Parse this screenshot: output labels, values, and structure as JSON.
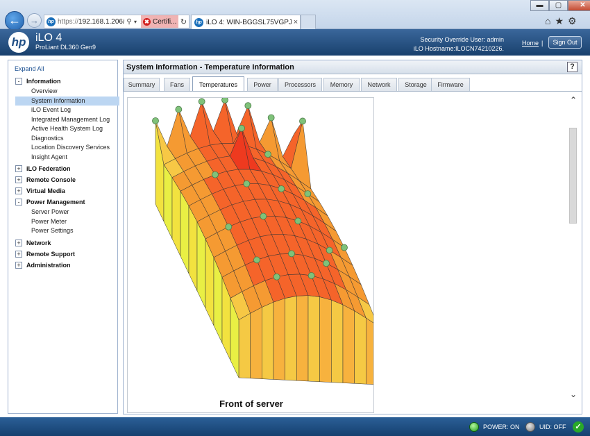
{
  "browser": {
    "url_prefix": "https://",
    "url_host": "192.168.1.206/i",
    "cert_label": "Certifi...",
    "tab_title": "iLO 4: WIN-BGGSL75VGPJ - ...",
    "close_glyph": "×",
    "back_glyph": "←",
    "fwd_glyph": "→",
    "search_glyph": "⚲",
    "drop_glyph": "▾",
    "refresh_glyph": "↻",
    "cert_x_glyph": "✖",
    "minimize_glyph": "▬",
    "maximize_glyph": "▢",
    "win_close_glyph": "✕",
    "home_glyph": "⌂",
    "star_glyph": "★",
    "gear_glyph": "⚙"
  },
  "header": {
    "logo_text": "hp",
    "product": "iLO 4",
    "model": "ProLiant DL360 Gen9",
    "security_user": "Security Override User:  admin",
    "hostname": "iLO Hostname:ILOCN74210226.",
    "home_link": "Home",
    "pipe": "|",
    "signout": "Sign Out"
  },
  "nav": {
    "expand_all": "Expand All",
    "sections": [
      {
        "label": "Information",
        "toggle": "-",
        "items": [
          "Overview",
          "System Information",
          "iLO Event Log",
          "Integrated Management Log",
          "Active Health System Log",
          "Diagnostics",
          "Location Discovery Services",
          "Insight Agent"
        ]
      },
      {
        "label": "iLO Federation",
        "toggle": "+",
        "items": []
      },
      {
        "label": "Remote Console",
        "toggle": "+",
        "items": []
      },
      {
        "label": "Virtual Media",
        "toggle": "+",
        "items": []
      },
      {
        "label": "Power Management",
        "toggle": "-",
        "items": [
          "Server Power",
          "Power Meter",
          "Power Settings"
        ]
      },
      {
        "label": "Network",
        "toggle": "+",
        "items": []
      },
      {
        "label": "Remote Support",
        "toggle": "+",
        "items": []
      },
      {
        "label": "Administration",
        "toggle": "+",
        "items": []
      }
    ],
    "selected": "System Information"
  },
  "main": {
    "title": "System Information - Temperature Information",
    "help": "?",
    "tabs": [
      "Summary",
      "Fans",
      "Temperatures",
      "Power",
      "Processors",
      "Memory",
      "Network",
      "Storage",
      "Firmware"
    ],
    "active_tab": "Temperatures",
    "plot_caption": "Front of server",
    "scroll_up": "⌃",
    "scroll_down": "⌄"
  },
  "footer": {
    "power": "POWER: ON",
    "uid": "UID: OFF",
    "status_glyph": "✓"
  },
  "colors": {
    "header_blue": "#19406d",
    "accent_blue": "#1a4f91",
    "selected_bg": "#bcd6f2",
    "hot": "#ee3a1f",
    "warm": "#f59a32",
    "cool": "#f2ee3c",
    "sensor": "#7fc27a"
  }
}
